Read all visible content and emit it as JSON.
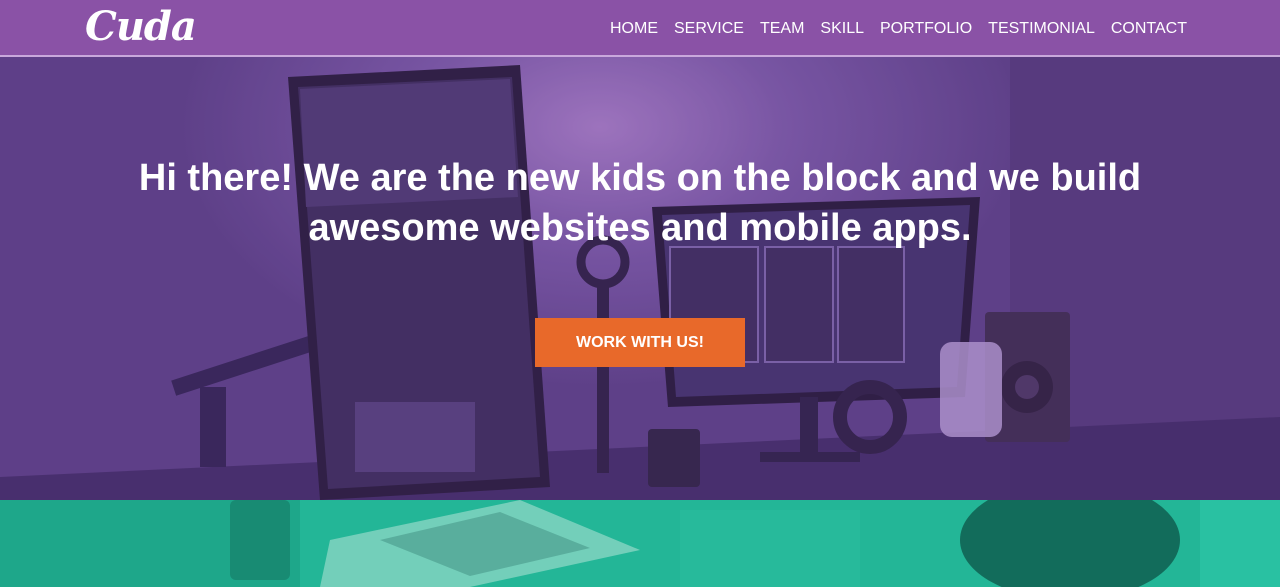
{
  "nav": {
    "logo": "Cuda",
    "links": [
      "HOME",
      "SERVICE",
      "TEAM",
      "SKILL",
      "PORTFOLIO",
      "TESTIMONIAL",
      "CONTACT"
    ]
  },
  "hero": {
    "headline": "Hi there! We are the new kids on the block and we build awesome websites and mobile apps.",
    "cta_label": "WORK WITH US!"
  },
  "colors": {
    "nav_bg": "#8a52a6",
    "hero_purple": "#6e4a9a",
    "cta": "#e8692a",
    "teal": "#1fb394"
  },
  "icons": {
    "logo": "cuda-wordmark"
  }
}
